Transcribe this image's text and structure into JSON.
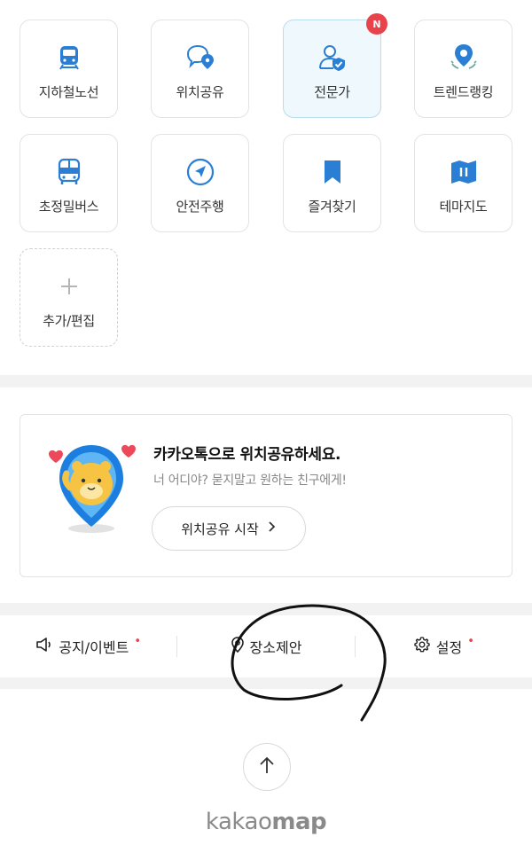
{
  "menu": {
    "tiles": [
      {
        "label": "지하철노선",
        "icon": "subway-icon"
      },
      {
        "label": "위치공유",
        "icon": "location-share-icon"
      },
      {
        "label": "전문가",
        "icon": "expert-icon",
        "badge": "N"
      },
      {
        "label": "트렌드랭킹",
        "icon": "trend-ranking-icon"
      },
      {
        "label": "초정밀버스",
        "icon": "bus-icon"
      },
      {
        "label": "안전주행",
        "icon": "safe-driving-icon"
      },
      {
        "label": "즐겨찾기",
        "icon": "bookmark-icon"
      },
      {
        "label": "테마지도",
        "icon": "theme-map-icon"
      },
      {
        "label": "추가/편집",
        "icon": "plus-icon"
      }
    ]
  },
  "promo": {
    "title": "카카오톡으로 위치공유하세요.",
    "subtitle": "너 어디야? 묻지말고 원하는 친구에게!",
    "button_label": "위치공유 시작",
    "button_icon": "chevron-right-icon"
  },
  "footer": {
    "notice_label": "공지/이벤트",
    "place_label": "장소제안",
    "settings_label": "설정",
    "dot": "•"
  },
  "logo": {
    "kakao": "kakao",
    "map": "map"
  },
  "colors": {
    "accent": "#2a7fd4",
    "badge": "#e8434b",
    "active_tile": "#eef8fd"
  }
}
